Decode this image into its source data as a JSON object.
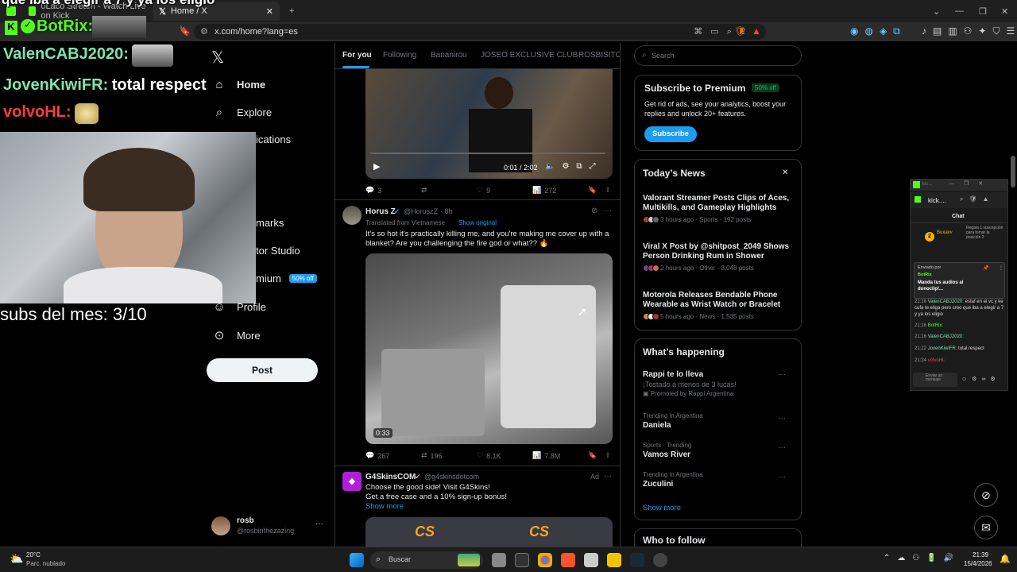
{
  "browser": {
    "tabs": [
      {
        "label": "0Laco Stream - Watch Live on Kick"
      },
      {
        "label": "Home / X"
      }
    ],
    "url": "x.com/home?lang=es"
  },
  "overlay": {
    "top_text": "que iba a elegir a 7 y ya los eligio",
    "botrix": "BotRix:",
    "chat": [
      {
        "user": "ValenCABJ2020:",
        "text": "",
        "color": "#7fe3b2"
      },
      {
        "user": "JovenKiwiFR:",
        "text": "total respect",
        "color": "#7fe3b2"
      },
      {
        "user": "volvoHL:",
        "text": "",
        "color": "#ff3b3b"
      }
    ],
    "subs": "subs del mes: 3/10"
  },
  "sidebar": {
    "items": [
      {
        "label": "Home",
        "icon": "home-icon"
      },
      {
        "label": "Explore",
        "icon": "search-icon"
      },
      {
        "label": "ications",
        "icon": "bell-icon"
      },
      {
        "label": "marks",
        "icon": "bookmark-icon"
      },
      {
        "label": "tor Studio",
        "icon": "studio-icon"
      },
      {
        "label": "mium",
        "icon": "premium-icon",
        "badge": "50% off"
      },
      {
        "label": "Profile",
        "icon": "person-icon"
      },
      {
        "label": "More",
        "icon": "more-icon"
      }
    ],
    "post_label": "Post",
    "account": {
      "name": "rosb",
      "handle": "@rosbinthezazing"
    }
  },
  "feed": {
    "tabs": [
      "For you",
      "Following",
      "Bananirou",
      "JOSEO EXCLUSIVE CLUB",
      "ROSBISITOS"
    ],
    "post1": {
      "time": "0:01 / 2:02",
      "replies": "3",
      "reposts": "",
      "likes": "9",
      "views": "272"
    },
    "post2": {
      "name": "Horus Z",
      "handle": "@HoruszZ",
      "age": "· 8h",
      "translated": "Translated from Vietnamese",
      "show_original": "Show original",
      "text": "It's so hot it's practically killing me, and you're making me cover up with a blanket? Are you challenging the fire god or what?? 🔥",
      "duration": "0:33",
      "replies": "267",
      "reposts": "196",
      "likes": "8.1K",
      "views": "7.8M"
    },
    "post3": {
      "name": "G4SkinsCOM",
      "handle": "@g4skinsdotcom",
      "ad": "Ad",
      "line1": "Choose the good side! Visit G4Skins!",
      "line2": "Get a free case and a 10% sign-up bonus!",
      "show_more": "Show more",
      "logo": "CS"
    }
  },
  "right": {
    "search_placeholder": "Search",
    "premium": {
      "title": "Subscribe to Premium",
      "badge": "50% off",
      "body": "Get rid of ads, see your analytics, boost your replies and unlock 20+ features.",
      "button": "Subscribe"
    },
    "news": {
      "title": "Today’s News",
      "items": [
        {
          "title": "Valorant Streamer Posts Clips of Aces, Multikills, and Gameplay Highlights",
          "meta": "3 hours ago · Sports · 192 posts"
        },
        {
          "title": "Viral X Post by @shitpost_2049 Shows Person Drinking Rum in Shower",
          "meta": "2 hours ago · Other · 3,048 posts"
        },
        {
          "title": "Motorola Releases Bendable Phone Wearable as Wrist Watch or Bracelet",
          "meta": "5 hours ago · News · 1,535 posts"
        }
      ]
    },
    "happening": {
      "title": "What’s happening",
      "items": [
        {
          "cat": "",
          "name": "Rappi te lo lleva",
          "sub": "¡Tostado a menos de 3 lucas!",
          "promo": "Promoted by Rappi Argentina"
        },
        {
          "cat": "Trending in Argentina",
          "name": "Daniela"
        },
        {
          "cat": "Sports · Trending",
          "name": "Vamos River"
        },
        {
          "cat": "Trending in Argentina",
          "name": "Zuculini"
        }
      ],
      "show_more": "Show more"
    },
    "who_to_follow": "Who to follow"
  },
  "kick_popup": {
    "title": "kick....",
    "chat_label": "Chat",
    "top_user": "Buxavv",
    "top_badge": "2",
    "top_sub": "Regala 1 suscripción para tomar la posición 2",
    "pinned_by": "Enviado por",
    "pinned_user": "BotRix",
    "pinned_text": "Manda tus audios al donoclip!...",
    "lines": [
      {
        "time": "21:16",
        "user": "ValenCABJ2020:",
        "text": "estaf en el vc y ke cufa te eliga pero creo que iba a elegir a 7 y ya los eligio"
      },
      {
        "time": "21:16",
        "user": "BotRix:",
        "text": ""
      },
      {
        "time": "21:16",
        "user": "ValenCABJ2020:",
        "text": ""
      },
      {
        "time": "21:22",
        "user": "JovenKiwiFR:",
        "text": "total respect"
      },
      {
        "time": "21:24",
        "user": "volvoHL:",
        "text": ""
      }
    ],
    "input_placeholder": "Enviar un mensaje"
  },
  "taskbar": {
    "weather_temp": "20°C",
    "weather_desc": "Parc. nublado",
    "search": "Buscar",
    "time": "21:39",
    "date": "15/4/2026"
  }
}
